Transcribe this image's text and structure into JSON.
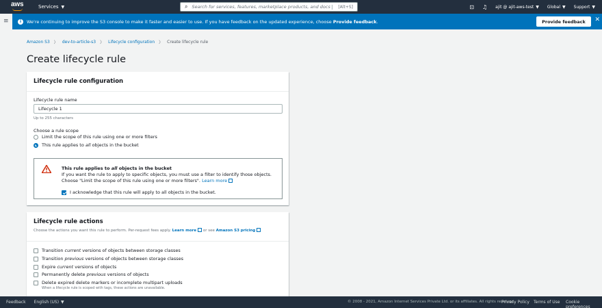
{
  "topnav": {
    "logo": "aws",
    "services_label": "Services",
    "search_placeholder": "Search for services, features, marketplace products, and docs",
    "search_shortcut": "[Alt+S]",
    "account": "ajit @ ajit-aws-test",
    "region": "Global",
    "support": "Support"
  },
  "banner": {
    "text_prefix": "We're continuing to improve the S3 console to make it faster and easier to use. If you have feedback on the updated experience, choose ",
    "text_bold": "Provide feedback",
    "text_suffix": ".",
    "button_label": "Provide feedback"
  },
  "breadcrumb": {
    "items": [
      "Amazon S3",
      "dev-to-article-s3",
      "Lifecycle configuration"
    ],
    "current": "Create lifecycle rule"
  },
  "page_title": "Create lifecycle rule",
  "config_card": {
    "title": "Lifecycle rule configuration",
    "name_label": "Lifecycle rule name",
    "name_value": "Lifecycle 1",
    "name_hint": "Up to 255 characters",
    "scope_label": "Choose a rule scope",
    "scope_options": [
      {
        "label": "Limit the scope of this rule using one or more filters",
        "selected": false
      },
      {
        "label_prefix": "This rule applies to ",
        "label_em": "all",
        "label_suffix": " objects in the bucket",
        "selected": true
      }
    ],
    "alert": {
      "title_prefix": "This rule applies to ",
      "title_em": "all",
      "title_suffix": " objects in the bucket",
      "body": "If you want the rule to apply to specific objects, you must use a filter to identify those objects. Choose \"Limit the scope of this rule using one or more filters\".",
      "learn_more": "Learn more",
      "ack_label": "I acknowledge that this rule will apply to all objects in the bucket.",
      "ack_checked": true
    }
  },
  "actions_card": {
    "title": "Lifecycle rule actions",
    "desc_prefix": "Choose the actions you want this rule to perform. Per-request fees apply. ",
    "learn_more": "Learn more",
    "or_see": " or see ",
    "pricing": "Amazon S3 pricing",
    "actions": [
      {
        "pre": "Transition ",
        "em": "current",
        "post": " versions of objects between storage classes"
      },
      {
        "pre": "Transition ",
        "em": "previous",
        "post": " versions of objects between storage classes"
      },
      {
        "pre": "Expire ",
        "em": "current",
        "post": " versions of objects"
      },
      {
        "pre": "Permanently delete ",
        "em": "previous",
        "post": " versions of objects"
      },
      {
        "pre": "Delete expired delete markers or incomplete multipart uploads",
        "em": "",
        "post": ""
      }
    ],
    "last_note": "When a lifecycle rule is scoped with tags, these actions are unavailable."
  },
  "footer": {
    "feedback": "Feedback",
    "language": "English (US)",
    "copyright": "© 2008 - 2021, Amazon Internet Services Private Ltd. or its affiliates. All rights reserved.",
    "privacy": "Privacy Policy",
    "terms": "Terms of Use",
    "cookies": "Cookie preferences"
  },
  "colors": {
    "nav_bg": "#232f3e",
    "banner_bg": "#0073bb",
    "link": "#0073bb",
    "warning": "#d13212"
  }
}
